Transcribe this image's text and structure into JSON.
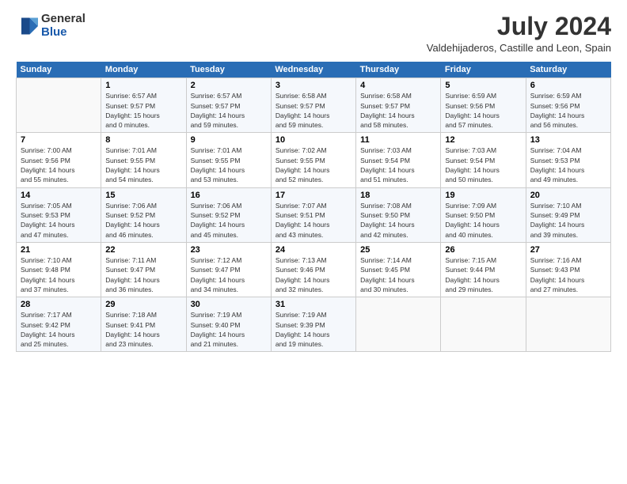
{
  "logo": {
    "general": "General",
    "blue": "Blue"
  },
  "title": "July 2024",
  "subtitle": "Valdehijaderos, Castille and Leon, Spain",
  "days_header": [
    "Sunday",
    "Monday",
    "Tuesday",
    "Wednesday",
    "Thursday",
    "Friday",
    "Saturday"
  ],
  "weeks": [
    [
      {
        "day": "",
        "info": ""
      },
      {
        "day": "1",
        "info": "Sunrise: 6:57 AM\nSunset: 9:57 PM\nDaylight: 15 hours\nand 0 minutes."
      },
      {
        "day": "2",
        "info": "Sunrise: 6:57 AM\nSunset: 9:57 PM\nDaylight: 14 hours\nand 59 minutes."
      },
      {
        "day": "3",
        "info": "Sunrise: 6:58 AM\nSunset: 9:57 PM\nDaylight: 14 hours\nand 59 minutes."
      },
      {
        "day": "4",
        "info": "Sunrise: 6:58 AM\nSunset: 9:57 PM\nDaylight: 14 hours\nand 58 minutes."
      },
      {
        "day": "5",
        "info": "Sunrise: 6:59 AM\nSunset: 9:56 PM\nDaylight: 14 hours\nand 57 minutes."
      },
      {
        "day": "6",
        "info": "Sunrise: 6:59 AM\nSunset: 9:56 PM\nDaylight: 14 hours\nand 56 minutes."
      }
    ],
    [
      {
        "day": "7",
        "info": "Sunrise: 7:00 AM\nSunset: 9:56 PM\nDaylight: 14 hours\nand 55 minutes."
      },
      {
        "day": "8",
        "info": "Sunrise: 7:01 AM\nSunset: 9:55 PM\nDaylight: 14 hours\nand 54 minutes."
      },
      {
        "day": "9",
        "info": "Sunrise: 7:01 AM\nSunset: 9:55 PM\nDaylight: 14 hours\nand 53 minutes."
      },
      {
        "day": "10",
        "info": "Sunrise: 7:02 AM\nSunset: 9:55 PM\nDaylight: 14 hours\nand 52 minutes."
      },
      {
        "day": "11",
        "info": "Sunrise: 7:03 AM\nSunset: 9:54 PM\nDaylight: 14 hours\nand 51 minutes."
      },
      {
        "day": "12",
        "info": "Sunrise: 7:03 AM\nSunset: 9:54 PM\nDaylight: 14 hours\nand 50 minutes."
      },
      {
        "day": "13",
        "info": "Sunrise: 7:04 AM\nSunset: 9:53 PM\nDaylight: 14 hours\nand 49 minutes."
      }
    ],
    [
      {
        "day": "14",
        "info": "Sunrise: 7:05 AM\nSunset: 9:53 PM\nDaylight: 14 hours\nand 47 minutes."
      },
      {
        "day": "15",
        "info": "Sunrise: 7:06 AM\nSunset: 9:52 PM\nDaylight: 14 hours\nand 46 minutes."
      },
      {
        "day": "16",
        "info": "Sunrise: 7:06 AM\nSunset: 9:52 PM\nDaylight: 14 hours\nand 45 minutes."
      },
      {
        "day": "17",
        "info": "Sunrise: 7:07 AM\nSunset: 9:51 PM\nDaylight: 14 hours\nand 43 minutes."
      },
      {
        "day": "18",
        "info": "Sunrise: 7:08 AM\nSunset: 9:50 PM\nDaylight: 14 hours\nand 42 minutes."
      },
      {
        "day": "19",
        "info": "Sunrise: 7:09 AM\nSunset: 9:50 PM\nDaylight: 14 hours\nand 40 minutes."
      },
      {
        "day": "20",
        "info": "Sunrise: 7:10 AM\nSunset: 9:49 PM\nDaylight: 14 hours\nand 39 minutes."
      }
    ],
    [
      {
        "day": "21",
        "info": "Sunrise: 7:10 AM\nSunset: 9:48 PM\nDaylight: 14 hours\nand 37 minutes."
      },
      {
        "day": "22",
        "info": "Sunrise: 7:11 AM\nSunset: 9:47 PM\nDaylight: 14 hours\nand 36 minutes."
      },
      {
        "day": "23",
        "info": "Sunrise: 7:12 AM\nSunset: 9:47 PM\nDaylight: 14 hours\nand 34 minutes."
      },
      {
        "day": "24",
        "info": "Sunrise: 7:13 AM\nSunset: 9:46 PM\nDaylight: 14 hours\nand 32 minutes."
      },
      {
        "day": "25",
        "info": "Sunrise: 7:14 AM\nSunset: 9:45 PM\nDaylight: 14 hours\nand 30 minutes."
      },
      {
        "day": "26",
        "info": "Sunrise: 7:15 AM\nSunset: 9:44 PM\nDaylight: 14 hours\nand 29 minutes."
      },
      {
        "day": "27",
        "info": "Sunrise: 7:16 AM\nSunset: 9:43 PM\nDaylight: 14 hours\nand 27 minutes."
      }
    ],
    [
      {
        "day": "28",
        "info": "Sunrise: 7:17 AM\nSunset: 9:42 PM\nDaylight: 14 hours\nand 25 minutes."
      },
      {
        "day": "29",
        "info": "Sunrise: 7:18 AM\nSunset: 9:41 PM\nDaylight: 14 hours\nand 23 minutes."
      },
      {
        "day": "30",
        "info": "Sunrise: 7:19 AM\nSunset: 9:40 PM\nDaylight: 14 hours\nand 21 minutes."
      },
      {
        "day": "31",
        "info": "Sunrise: 7:19 AM\nSunset: 9:39 PM\nDaylight: 14 hours\nand 19 minutes."
      },
      {
        "day": "",
        "info": ""
      },
      {
        "day": "",
        "info": ""
      },
      {
        "day": "",
        "info": ""
      }
    ]
  ]
}
